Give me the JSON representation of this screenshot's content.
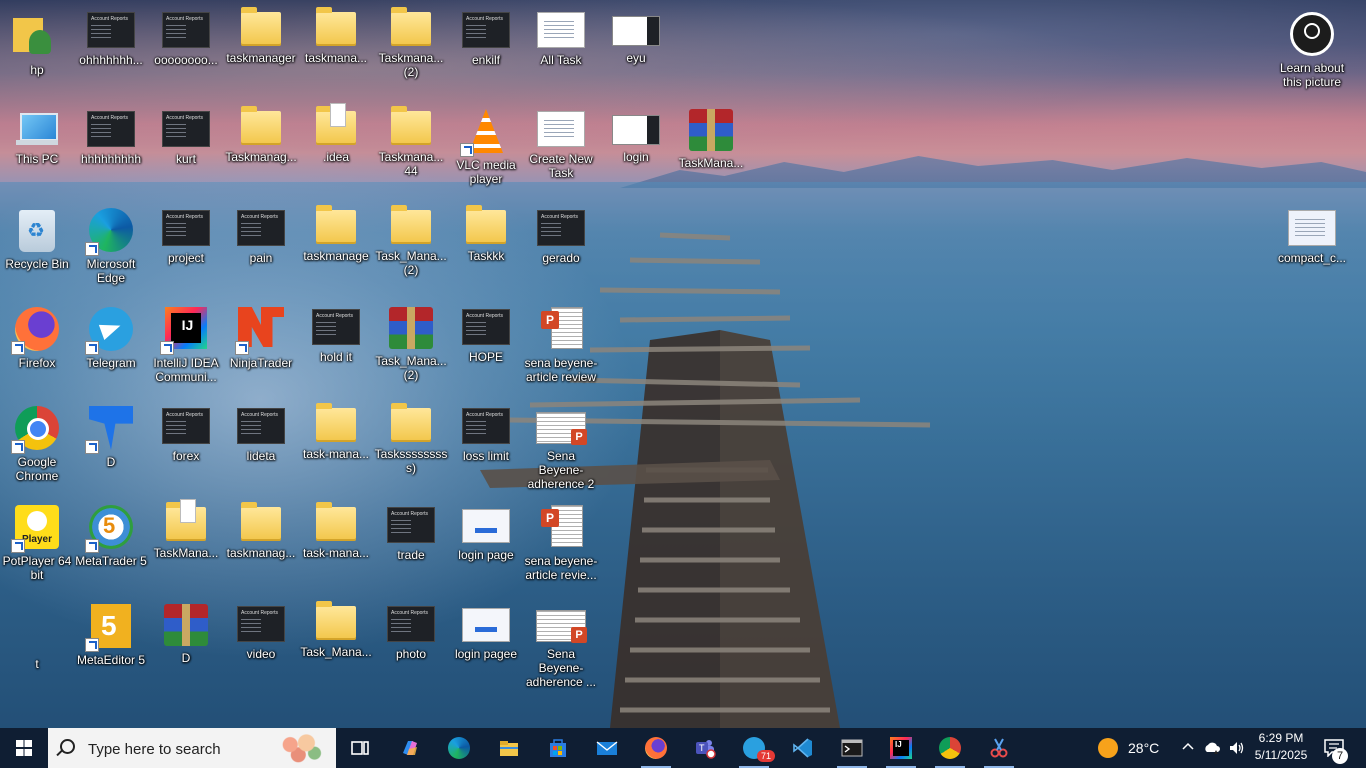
{
  "desktop": {
    "icons": [
      {
        "label": "hp"
      },
      {
        "label": "ohhhhhhh..."
      },
      {
        "label": "oooooooo..."
      },
      {
        "label": "taskmanager"
      },
      {
        "label": "taskmana..."
      },
      {
        "label": "Taskmana...\n(2)"
      },
      {
        "label": "enkilf"
      },
      {
        "label": "All Task"
      },
      {
        "label": "eyu"
      },
      {
        "label": "This PC"
      },
      {
        "label": "hhhhhhhhh"
      },
      {
        "label": "kurt"
      },
      {
        "label": "Taskmanag..."
      },
      {
        "label": ".idea"
      },
      {
        "label": "Taskmana...\n44"
      },
      {
        "label": "VLC media\nplayer"
      },
      {
        "label": "Create New\nTask"
      },
      {
        "label": "login"
      },
      {
        "label": "TaskMana..."
      },
      {
        "label": "Recycle Bin"
      },
      {
        "label": "Microsoft\nEdge"
      },
      {
        "label": "project"
      },
      {
        "label": "pain"
      },
      {
        "label": "taskmanage"
      },
      {
        "label": "Task_Mana...\n(2)"
      },
      {
        "label": "Taskkk"
      },
      {
        "label": "gerado"
      },
      {
        "label": "Firefox"
      },
      {
        "label": "Telegram"
      },
      {
        "label": "IntelliJ IDEA\nCommuni..."
      },
      {
        "label": "NinjaTrader"
      },
      {
        "label": "hold it"
      },
      {
        "label": "Task_Mana...\n(2)"
      },
      {
        "label": "HOPE"
      },
      {
        "label": "sena beyene-\narticle review"
      },
      {
        "label": "Google\nChrome"
      },
      {
        "label": "D"
      },
      {
        "label": "forex"
      },
      {
        "label": "lideta"
      },
      {
        "label": "task-mana..."
      },
      {
        "label": "Tasksssssssss)"
      },
      {
        "label": "loss limit"
      },
      {
        "label": "Sena Beyene-\nadherence 2"
      },
      {
        "label": "PotPlayer 64\nbit"
      },
      {
        "label": "MetaTrader 5"
      },
      {
        "label": "TaskMana..."
      },
      {
        "label": "taskmanag..."
      },
      {
        "label": "task-mana..."
      },
      {
        "label": "trade"
      },
      {
        "label": "login page"
      },
      {
        "label": "sena beyene-\narticle revie..."
      },
      {
        "label": "t"
      },
      {
        "label": "MetaEditor 5"
      },
      {
        "label": "D"
      },
      {
        "label": "video"
      },
      {
        "label": "Task_Mana..."
      },
      {
        "label": "photo"
      },
      {
        "label": "login pagee"
      },
      {
        "label": "Sena Beyene-\nadherence ..."
      }
    ],
    "right_icons": [
      {
        "label": "Learn about\nthis picture"
      },
      {
        "label": "compact_c..."
      }
    ]
  },
  "taskbar": {
    "search_placeholder": "Type here to search",
    "apps": [
      {
        "icon": "task-view-icon"
      },
      {
        "icon": "copilot-icon"
      },
      {
        "icon": "edge-icon"
      },
      {
        "icon": "file-explorer-icon"
      },
      {
        "icon": "microsoft-store-icon"
      },
      {
        "icon": "mail-icon"
      },
      {
        "icon": "firefox-icon"
      },
      {
        "icon": "teams-icon"
      },
      {
        "icon": "telegram-icon",
        "badge": "71"
      },
      {
        "icon": "vscode-icon"
      },
      {
        "icon": "terminal-icon"
      },
      {
        "icon": "intellij-icon"
      },
      {
        "icon": "chrome-icon"
      },
      {
        "icon": "snipping-tool-icon"
      }
    ],
    "weather": {
      "temp": "28°C"
    },
    "clock": {
      "time": "6:29 PM",
      "date": "5/11/2025"
    },
    "notifications": {
      "count": "7"
    }
  }
}
